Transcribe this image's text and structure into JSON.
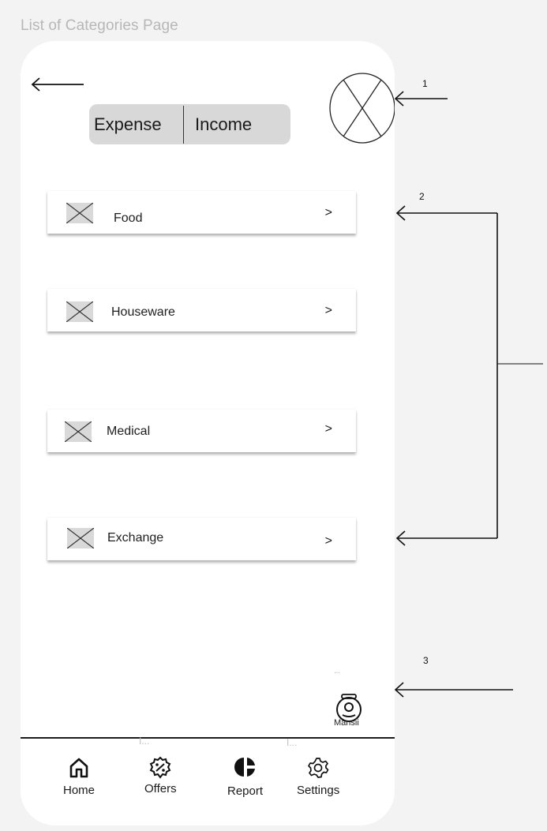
{
  "page_title": "List of Categories Page",
  "tabs": {
    "expense_label": "Expense",
    "income_label": "Income"
  },
  "categories": [
    {
      "label": "Food",
      "chevron": ">"
    },
    {
      "label": "Houseware",
      "chevron": ">"
    },
    {
      "label": "Medical",
      "chevron": ">"
    },
    {
      "label": "Exchange",
      "chevron": ">"
    }
  ],
  "assistant": {
    "dots": "...",
    "label": "Mansii"
  },
  "bottom_nav": {
    "items": [
      {
        "label": "Home",
        "icon": "home-icon"
      },
      {
        "label": "Offers",
        "icon": "offers-icon"
      },
      {
        "label": "Report",
        "icon": "report-icon"
      },
      {
        "label": "Settings",
        "icon": "settings-icon"
      }
    ],
    "markers": [
      "I...",
      "I..."
    ]
  },
  "annotations": [
    "1",
    "2",
    "3"
  ],
  "colors": {
    "background": "#f3f3f3",
    "phone": "#ffffff",
    "segment": "#d8d8d8",
    "placeholder_fill": "#d9d9d9",
    "text": "#1a1a1a"
  }
}
